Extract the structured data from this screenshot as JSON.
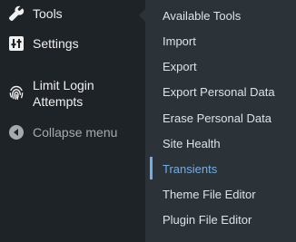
{
  "sidebar": {
    "items": [
      {
        "label": "Tools",
        "icon": "wrench-icon"
      },
      {
        "label": "Settings",
        "icon": "settings-sliders-icon"
      },
      {
        "label": "Limit Login Attempts",
        "icon": "fingerprint-icon"
      },
      {
        "label": "Collapse menu",
        "icon": "collapse-arrow-icon"
      }
    ]
  },
  "submenu": {
    "items": [
      {
        "label": "Available Tools"
      },
      {
        "label": "Import"
      },
      {
        "label": "Export"
      },
      {
        "label": "Export Personal Data"
      },
      {
        "label": "Erase Personal Data"
      },
      {
        "label": "Site Health"
      },
      {
        "label": "Transients",
        "current": true
      },
      {
        "label": "Theme File Editor"
      },
      {
        "label": "Plugin File Editor"
      }
    ]
  },
  "colors": {
    "sidebar_bg": "#1d2327",
    "submenu_bg": "#2c3338",
    "text": "#f0f0f1",
    "muted": "#a7aaad",
    "accent": "#72aee6"
  }
}
